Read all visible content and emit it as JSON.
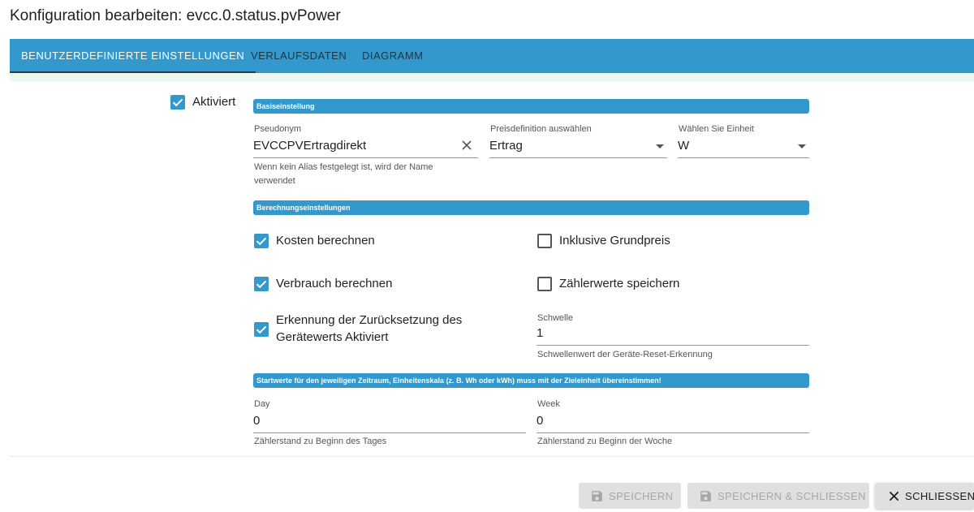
{
  "dialog": {
    "title": "Konfiguration bearbeiten: evcc.0.status.pvPower"
  },
  "tabs": [
    {
      "label": "BENUTZERDEFINIERTE EINSTELLUNGEN",
      "active": true
    },
    {
      "label": "VERLAUFSDATEN",
      "active": false
    },
    {
      "label": "DIAGRAMM",
      "active": false
    }
  ],
  "activated": {
    "label": "Aktiviert",
    "checked": true
  },
  "sections": {
    "basic": "Basiseinstellung",
    "calculation": "Berechnungseinstellungen",
    "start_values": "Startwerte für den jeweiligen Zeitraum, Einheitenskala (z. B. Wh oder kWh) muss mit der Zieleinheit übereinstimmen!"
  },
  "pseudonym": {
    "label": "Pseudonym",
    "value": "EVCCPVErtragdirekt",
    "helper_line1": "Wenn kein Alias festgelegt ist, wird der Name",
    "helper_line2": "verwendet"
  },
  "price_definition": {
    "label": "Preisdefinition auswählen",
    "value": "Ertrag"
  },
  "unit": {
    "label": "Wählen Sie Einheit",
    "value": "W"
  },
  "options": {
    "calc_costs": {
      "label": "Kosten berechnen",
      "checked": true
    },
    "include_base_price": {
      "label": "Inklusive Grundpreis",
      "checked": false
    },
    "calc_consumption": {
      "label": "Verbrauch berechnen",
      "checked": true
    },
    "save_meter_values": {
      "label": "Zählerwerte speichern",
      "checked": false
    },
    "reset_detection_line1": "Erkennung der Zurücksetzung des",
    "reset_detection_line2": "Gerätewerts Aktiviert",
    "reset_detection_checked": true
  },
  "threshold": {
    "label": "Schwelle",
    "value": "1",
    "helper": "Schwellenwert der Geräte-Reset-Erkennung"
  },
  "day": {
    "label": "Day",
    "value": "0",
    "helper": "Zählerstand zu Beginn des Tages"
  },
  "week": {
    "label": "Week",
    "value": "0",
    "helper": "Zählerstand zu Beginn der Woche"
  },
  "buttons": {
    "save": "SPEICHERN",
    "save_close": "SPEICHERN & SCHLIESSEN",
    "close": "SCHLIESSEN"
  },
  "icons": {
    "check": "check-icon",
    "clear": "close-icon",
    "dropdown": "chevron-down-icon",
    "save": "floppy-disk-icon"
  },
  "colors": {
    "accent": "#3399cc",
    "tab_indicator": "#1e3d5a",
    "tab_text_inactive": "#1e3342"
  }
}
